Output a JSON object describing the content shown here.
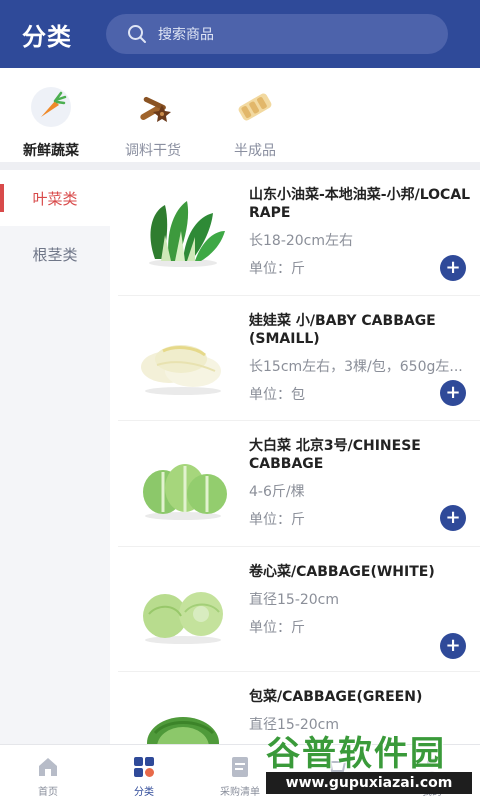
{
  "header": {
    "title": "分类",
    "search_placeholder": "搜索商品"
  },
  "categories": [
    {
      "label": "新鲜蔬菜",
      "icon": "carrot-icon",
      "active": true
    },
    {
      "label": "调料干货",
      "icon": "spices-icon",
      "active": false
    },
    {
      "label": "半成品",
      "icon": "rolls-icon",
      "active": false
    }
  ],
  "subcategories": [
    {
      "label": "叶菜类",
      "active": true
    },
    {
      "label": "根茎类",
      "active": false
    }
  ],
  "products": [
    {
      "name": "山东小油菜-本地油菜-小邦/LOCAL RAPE",
      "spec": "长18-20cm左右",
      "unit": "单位：斤",
      "icon": "bok-choy-icon"
    },
    {
      "name": "娃娃菜 小/BABY CABBAGE (SMAILL)",
      "spec": "长15cm左右，3棵/包，650g左...",
      "unit": "单位：包",
      "icon": "baby-cabbage-icon"
    },
    {
      "name": "大白菜 北京3号/CHINESE CABBAGE",
      "spec": "4-6斤/棵",
      "unit": "单位：斤",
      "icon": "chinese-cabbage-icon"
    },
    {
      "name": "卷心菜/CABBAGE(WHITE)",
      "spec": "直径15-20cm",
      "unit": "单位：斤",
      "icon": "white-cabbage-icon"
    },
    {
      "name": "包菜/CABBAGE(GREEN)",
      "spec": "直径15-20cm",
      "unit": "",
      "icon": "green-cabbage-icon"
    }
  ],
  "add_label": "+",
  "bottom_nav": [
    {
      "label": "首页",
      "icon": "home-icon",
      "active": false
    },
    {
      "label": "分类",
      "icon": "category-icon",
      "active": true
    },
    {
      "label": "采购清单",
      "icon": "list-icon",
      "active": false
    },
    {
      "label": "",
      "icon": "cart-icon",
      "active": false
    },
    {
      "label": "我的",
      "icon": "user-icon",
      "active": false
    }
  ],
  "watermark": {
    "title": "谷普软件园",
    "url": "www.gupuxiazai.com"
  },
  "colors": {
    "brand": "#2f4a99",
    "active_red": "#d84a4a",
    "watermark_green": "#3a9a3a"
  }
}
